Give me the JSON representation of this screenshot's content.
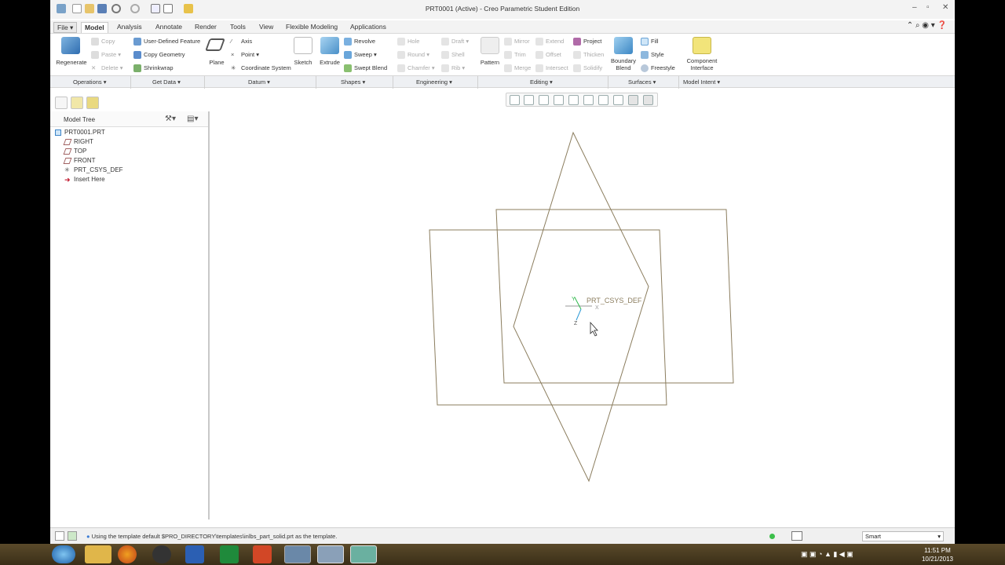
{
  "window": {
    "title": "PRT0001 (Active) - Creo Parametric Student Edition",
    "controls": [
      "–",
      "▫",
      "✕"
    ]
  },
  "tabs": [
    "File ▾",
    "Model",
    "Analysis",
    "Annotate",
    "Render",
    "Tools",
    "View",
    "Flexible Modeling",
    "Applications"
  ],
  "active_tab": "Model",
  "ribbon": {
    "regenerate": "Regenerate",
    "copy": "Copy",
    "paste": "Paste",
    "delete": "Delete",
    "udf": "User-Defined Feature",
    "copy_geometry": "Copy Geometry",
    "shrinkwrap": "Shrinkwrap",
    "plane": "Plane",
    "axis": "Axis",
    "point": "Point",
    "csys": "Coordinate System",
    "sketch": "Sketch",
    "extrude": "Extrude",
    "revolve": "Revolve",
    "sweep": "Sweep",
    "swept_blend": "Swept Blend",
    "hole": "Hole",
    "round": "Round",
    "chamfer": "Chamfer",
    "draft": "Draft",
    "shell": "Shell",
    "rib": "Rib",
    "pattern": "Pattern",
    "mirror": "Mirror",
    "trim": "Trim",
    "merge": "Merge",
    "extend": "Extend",
    "offset": "Offset",
    "intersect": "Intersect",
    "project": "Project",
    "thicken": "Thicken",
    "solidify": "Solidify",
    "boundary_blend": "Boundary Blend",
    "fill": "Fill",
    "style": "Style",
    "freestyle": "Freestyle",
    "component_interface": "Component Interface"
  },
  "groups": [
    "Operations ▾",
    "Get Data ▾",
    "Datum ▾",
    "Shapes ▾",
    "Engineering ▾",
    "Editing ▾",
    "Surfaces ▾",
    "Model Intent ▾"
  ],
  "model_tree": {
    "title": "Model Tree",
    "items": [
      "PRT0001.PRT",
      "RIGHT",
      "TOP",
      "FRONT",
      "PRT_CSYS_DEF",
      "Insert Here"
    ]
  },
  "viewport": {
    "csys_label": "PRT_CSYS_DEF",
    "axis_x": "X",
    "axis_y": "Y",
    "axis_z": "Z"
  },
  "status": {
    "message": "Using the template default $PRO_DIRECTORY\\templates\\inlbs_part_solid.prt as the template.",
    "filter": "Smart"
  },
  "taskbar": {
    "time": "11:51 PM",
    "date": "10/21/2013"
  },
  "colors": {
    "datum_plane": "#8b7d5e",
    "accent": "#3a7bd5",
    "taskbar": "#4a3c20"
  }
}
